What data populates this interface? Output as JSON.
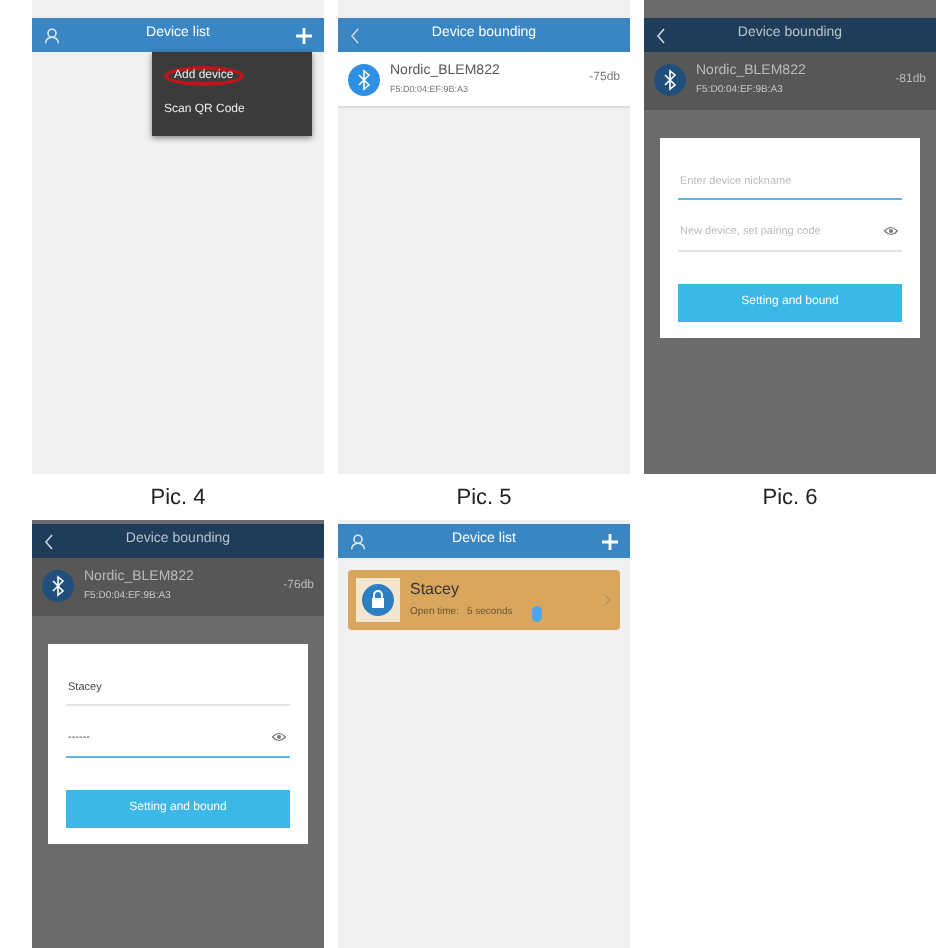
{
  "panels": [
    {
      "kind": "list_menu",
      "caption": "Pic. 4",
      "title": "Device list",
      "menu": [
        {
          "label": "Add device",
          "highlighted": true
        },
        {
          "label": "Scan QR Code",
          "highlighted": false
        }
      ]
    },
    {
      "kind": "scan",
      "caption": "Pic. 5",
      "title": "Device bounding",
      "device": {
        "name": "Nordic_BLEM822",
        "mac": "F5:D0:04:EF:9B:A3",
        "rssi": "-75db"
      }
    },
    {
      "kind": "dialog",
      "caption": "Pic. 6",
      "title": "Device bounding",
      "device": {
        "name": "Nordic_BLEM822",
        "mac": "F5:D0:04:EF:9B:A3",
        "rssi": "-81db"
      },
      "fields": [
        {
          "placeholder": "Enter device nickname",
          "focused": true
        },
        {
          "placeholder": "New device, set pairing code",
          "focused": false
        }
      ],
      "button": "Setting and bound"
    },
    {
      "kind": "dialog",
      "title": "Device bounding",
      "device": {
        "name": "Nordic_BLEM822",
        "mac": "F5:D0:04:EF:9B:A3",
        "rssi": "-76db"
      },
      "fields": [
        {
          "value": "Stacey",
          "focused": false
        },
        {
          "value": "------",
          "focused": true
        }
      ],
      "button": "Setting and bound"
    },
    {
      "kind": "list",
      "title": "Device list",
      "cards": [
        {
          "name": "Stacey",
          "label": "Open time:",
          "time": "5 seconds"
        }
      ]
    }
  ]
}
